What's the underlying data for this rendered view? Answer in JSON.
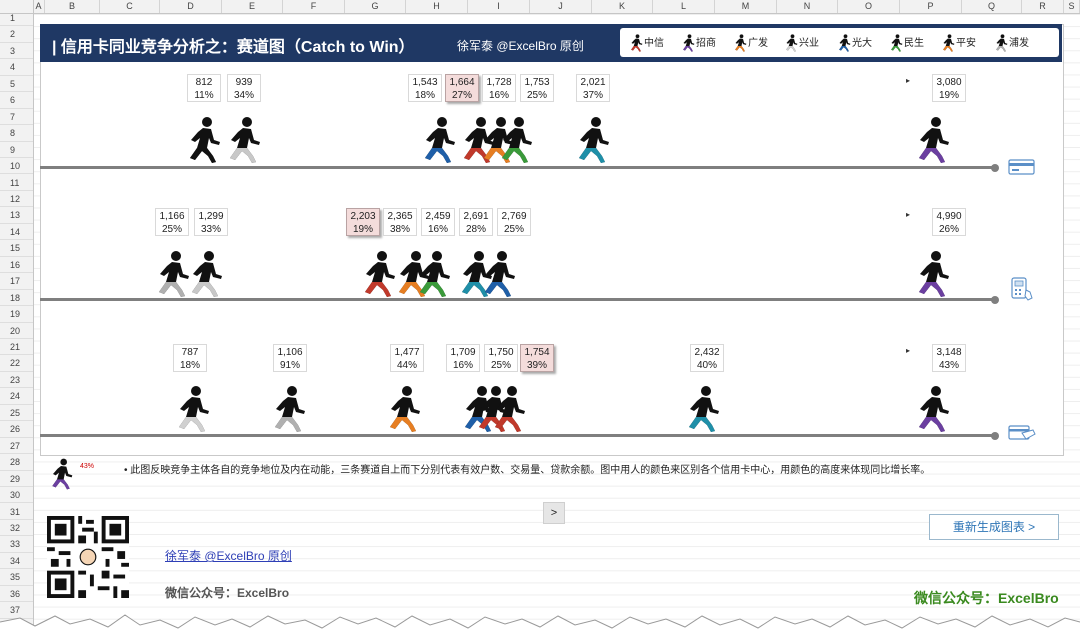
{
  "spreadsheet": {
    "columns": [
      "A",
      "B",
      "C",
      "D",
      "E",
      "F",
      "G",
      "H",
      "I",
      "J",
      "K",
      "L",
      "M",
      "N",
      "O",
      "P",
      "Q",
      "R",
      "S"
    ],
    "rows": [
      "1",
      "2",
      "3",
      "4",
      "5",
      "6",
      "7",
      "8",
      "9",
      "10",
      "11",
      "12",
      "13",
      "14",
      "15",
      "16",
      "17",
      "18",
      "19",
      "20",
      "21",
      "22",
      "23",
      "24",
      "25",
      "26",
      "27",
      "28",
      "29",
      "30",
      "31",
      "32",
      "33",
      "34",
      "35",
      "36",
      "37",
      "38"
    ]
  },
  "header": {
    "title": "| 信用卡同业竞争分析之：赛道图（Catch to Win）",
    "author": "徐军泰 @ExcelBro 原创"
  },
  "legend": [
    {
      "label": "中信",
      "color": "#c0392b"
    },
    {
      "label": "招商",
      "color": "#6b3fa0"
    },
    {
      "label": "广发",
      "color": "#e67e22"
    },
    {
      "label": "兴业",
      "color": "#d0d0d0"
    },
    {
      "label": "光大",
      "color": "#1f5fa8"
    },
    {
      "label": "民生",
      "color": "#3a9a3a"
    },
    {
      "label": "平安",
      "color": "#e67e22"
    },
    {
      "label": "浦发",
      "color": "#b0b0b0"
    }
  ],
  "lanes": [
    {
      "name": "有效户数",
      "icon": "card-icon",
      "labels": [
        {
          "value": "812",
          "pct": "11%",
          "hl": false
        },
        {
          "value": "939",
          "pct": "34%",
          "hl": false
        },
        {
          "value": "1,543",
          "pct": "18%",
          "hl": false
        },
        {
          "value": "1,664",
          "pct": "27%",
          "hl": true
        },
        {
          "value": "1,728",
          "pct": "16%",
          "hl": false
        },
        {
          "value": "1,753",
          "pct": "25%",
          "hl": false
        },
        {
          "value": "2,021",
          "pct": "37%",
          "hl": false
        },
        {
          "value": "3,080",
          "pct": "19%",
          "hl": false
        }
      ]
    },
    {
      "name": "交易量",
      "icon": "pos-terminal-icon",
      "labels": [
        {
          "value": "1,166",
          "pct": "25%",
          "hl": false
        },
        {
          "value": "1,299",
          "pct": "33%",
          "hl": false
        },
        {
          "value": "2,203",
          "pct": "19%",
          "hl": true
        },
        {
          "value": "2,365",
          "pct": "38%",
          "hl": false
        },
        {
          "value": "2,459",
          "pct": "16%",
          "hl": false
        },
        {
          "value": "2,691",
          "pct": "28%",
          "hl": false
        },
        {
          "value": "2,769",
          "pct": "25%",
          "hl": false
        },
        {
          "value": "4,990",
          "pct": "26%",
          "hl": false
        }
      ]
    },
    {
      "name": "贷款余额",
      "icon": "loan-icon",
      "labels": [
        {
          "value": "787",
          "pct": "18%",
          "hl": false
        },
        {
          "value": "1,106",
          "pct": "91%",
          "hl": false
        },
        {
          "value": "1,477",
          "pct": "44%",
          "hl": false
        },
        {
          "value": "1,709",
          "pct": "16%",
          "hl": false
        },
        {
          "value": "1,750",
          "pct": "25%",
          "hl": false
        },
        {
          "value": "1,754",
          "pct": "39%",
          "hl": true
        },
        {
          "value": "2,432",
          "pct": "40%",
          "hl": false
        },
        {
          "value": "3,148",
          "pct": "43%",
          "hl": false
        }
      ]
    }
  ],
  "note": "• 此图反映竞争主体各自的竞争地位及内在动能，三条赛道自上而下分别代表有效户数、交易量、贷款余额。图中用人的颜色来区别各个信用卡中心，用颜色的高度来体现同比增长率。",
  "legend_sample": {
    "pct": "43%"
  },
  "nav_button": ">",
  "regen_button": "重新生成图表 >",
  "author_link": "徐军泰 @ExcelBro 原创",
  "wechat": "微信公众号：ExcelBro",
  "brand": "微信公众号：ExcelBro"
}
